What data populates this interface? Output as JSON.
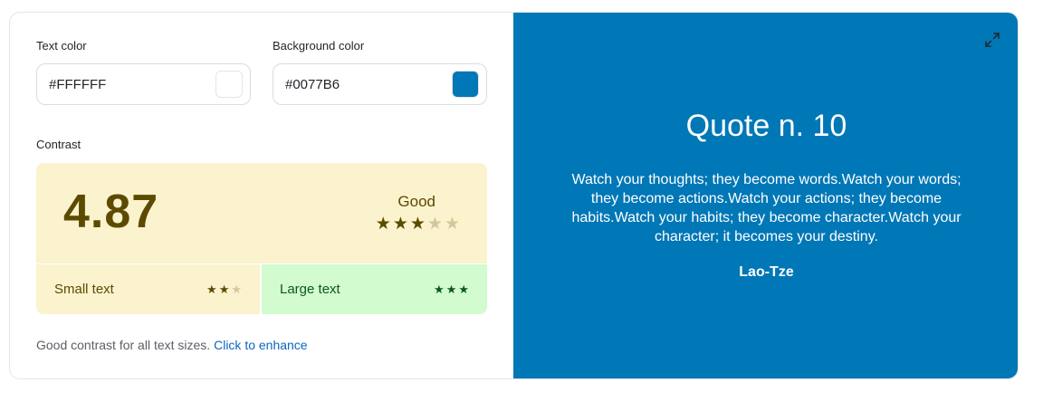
{
  "text_color": {
    "label": "Text color",
    "value": "#FFFFFF",
    "swatch": "#FFFFFF"
  },
  "background_color": {
    "label": "Background color",
    "value": "#0077B6",
    "swatch": "#0077B6"
  },
  "contrast": {
    "label": "Contrast",
    "ratio": "4.87",
    "rating": "Good",
    "stars": 3,
    "max_stars": 5,
    "small_text": {
      "label": "Small text",
      "stars": 2,
      "max_stars": 3
    },
    "large_text": {
      "label": "Large text",
      "stars": 3,
      "max_stars": 3
    }
  },
  "footer": {
    "note": "Good contrast for all text sizes.",
    "link": "Click to enhance"
  },
  "preview": {
    "title": "Quote n. 10",
    "quote": "Watch your thoughts; they become words.Watch your words; they become actions.Watch your actions; they become habits.Watch your habits; they become character.Watch your character; it becomes your destiny.",
    "author": "Lao-Tze",
    "expand_icon": "expand-icon"
  },
  "colors": {
    "rating_bg": "#FAF3CD",
    "rating_fg": "#5C4A00",
    "large_bg": "#D2FBD0",
    "large_fg": "#0B5A1A",
    "preview_bg": "#0077B6",
    "preview_fg": "#FFFFFF"
  }
}
